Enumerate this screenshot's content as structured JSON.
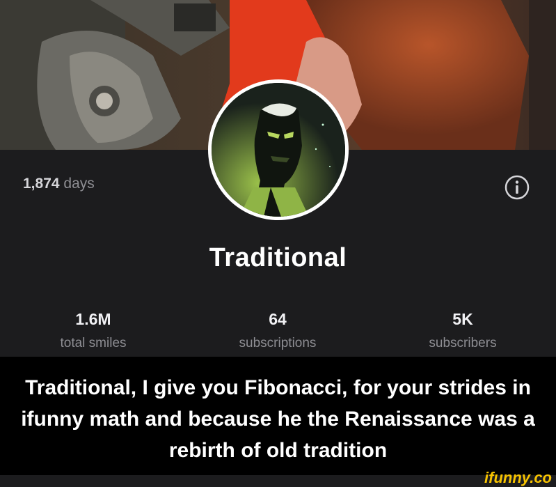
{
  "profile": {
    "days_count": "1,874",
    "days_label": "days",
    "name": "Traditional"
  },
  "stats": [
    {
      "value": "1.6M",
      "label": "total smiles"
    },
    {
      "value": "64",
      "label": "subscriptions"
    },
    {
      "value": "5K",
      "label": "subscribers"
    }
  ],
  "caption": "Traditional, I give you Fibonacci, for your strides in ifunny math and because he the Renaissance was a rebirth of old tradition",
  "watermark": "ifunny.co",
  "icons": {
    "info": "info-icon"
  },
  "colors": {
    "background": "#1c1c1e",
    "caption_bg": "#000000",
    "watermark": "#f7c300"
  }
}
